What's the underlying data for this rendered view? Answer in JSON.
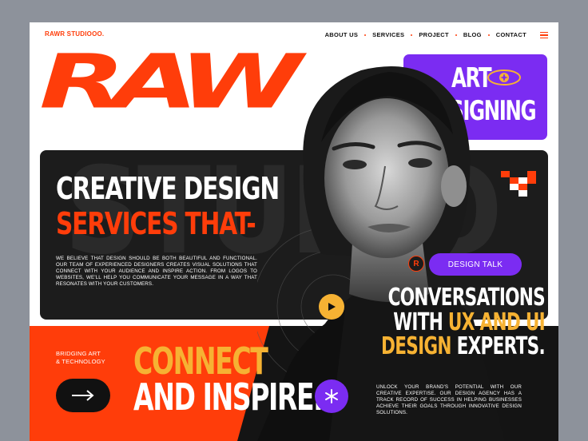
{
  "brand": {
    "logo": "RAWR STUDIOOO.",
    "accent_color": "#ff3d0a",
    "purple_color": "#7b2cf2",
    "yellow_color": "#f6b233"
  },
  "nav": {
    "items": [
      {
        "label": "ABOUT US"
      },
      {
        "label": "SERVICES"
      },
      {
        "label": "PROJECT"
      },
      {
        "label": "BLOG"
      },
      {
        "label": "CONTACT"
      }
    ],
    "menu_icon": "hamburger-icon"
  },
  "hero": {
    "big_word": "RAW",
    "purple_card": {
      "line1": "ART",
      "line2": "DESIGNING",
      "icon": "eye-icon"
    },
    "ghost_word": "STUDIO",
    "headline_white": "CREATIVE DESIGN",
    "headline_orange": "SERVICES THAT-",
    "paragraph": "WE BELIEVE THAT DESIGN SHOULD BE BOTH BEAUTIFUL AND FUNCTIONAL. OUR TEAM OF EXPERIENCED DESIGNERS CREATES VISUAL SOLUTIONS THAT CONNECT WITH YOUR AUDIENCE AND INSPIRE ACTION. FROM LOGOS TO WEBSITES, WE'LL HELP YOU COMMUNICATE YOUR MESSAGE IN A WAY THAT RESONATES WITH YOUR CUSTOMERS."
  },
  "design_talk": {
    "badge": "R",
    "label": "DESIGN TALK"
  },
  "conversations": {
    "line1": "CONVERSATIONS",
    "line2_a": "WITH ",
    "line2_b": "UX AND UI",
    "line3_a": "DESIGN",
    "line3_b": " EXPERTS."
  },
  "bottom": {
    "bridging": "BRIDGING ART\n& TECHNOLOGY",
    "connect": "CONNECT",
    "inspire": "AND INSPIRE.",
    "paragraph": "UNLOCK YOUR BRAND'S POTENTIAL WITH OUR CREATIVE EXPERTISE. OUR DESIGN AGENCY HAS A TRACK RECORD OF SUCCESS IN HELPING BUSINESSES ACHIEVE THEIR GOALS THROUGH INNOVATIVE DESIGN SOLUTIONS."
  }
}
